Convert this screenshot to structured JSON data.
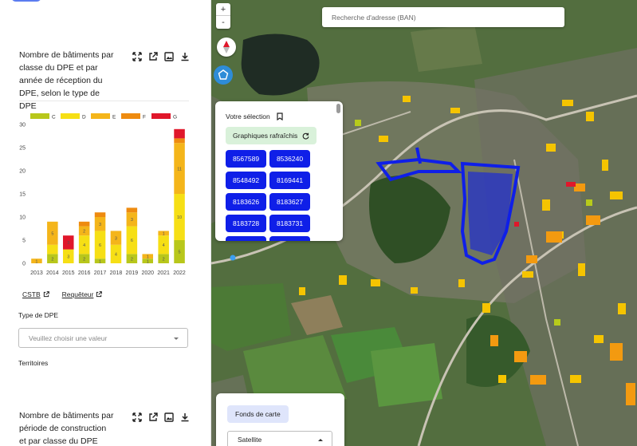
{
  "left_panel": {
    "card1": {
      "title": "Nombre de bâtiments par classe du DPE et par année de réception du DPE, selon le type de DPE"
    },
    "links": {
      "cstb": "CSTB",
      "requeteur": "Requêteur"
    },
    "type_dpe_label": "Type de DPE",
    "type_dpe_placeholder": "Veuillez choisir une valeur",
    "territoires_label": "Territoires",
    "card2": {
      "title": "Nombre de bâtiments par période de construction et par classe du DPE"
    },
    "tool_icons": [
      "expand-icon",
      "external-link-icon",
      "image-icon",
      "download-icon"
    ]
  },
  "map": {
    "zoom_in": "+",
    "zoom_out": "-",
    "search_placeholder": "Recherche d'adresse (BAN)",
    "selection": {
      "title": "Votre sélection",
      "refresh_label": "Graphiques rafraîchis",
      "ids": [
        "8567589",
        "8536240",
        "8548492",
        "8169441",
        "8183626",
        "8183627",
        "8183728",
        "8183731"
      ]
    },
    "basemap": {
      "button_label": "Fonds de carte",
      "selected": "Satellite"
    }
  },
  "colors": {
    "C": "#b8c71b",
    "D": "#f6df15",
    "E": "#f4b51a",
    "F": "#ee8b10",
    "G": "#e0172b",
    "selection": "#0f1fe8"
  },
  "chart_data": {
    "type": "bar",
    "stacked": true,
    "categories": [
      "2013",
      "2014",
      "2015",
      "2016",
      "2017",
      "2018",
      "2019",
      "2020",
      "2021",
      "2022"
    ],
    "series": [
      {
        "name": "C",
        "values": [
          0,
          2,
          0,
          2,
          1,
          0,
          2,
          1,
          2,
          5
        ]
      },
      {
        "name": "D",
        "values": [
          0,
          2,
          3,
          4,
          6,
          4,
          6,
          0,
          4,
          10
        ]
      },
      {
        "name": "E",
        "values": [
          1,
          5,
          0,
          2,
          3,
          3,
          3,
          1,
          1,
          11
        ]
      },
      {
        "name": "F",
        "values": [
          0,
          0,
          0,
          1,
          1,
          0,
          1,
          0,
          0,
          1
        ]
      },
      {
        "name": "G",
        "values": [
          0,
          0,
          3,
          0,
          0,
          0,
          0,
          0,
          0,
          2
        ]
      }
    ],
    "data_labels": [
      [
        "",
        "2",
        "",
        "2",
        "1",
        "",
        "2",
        "1",
        "2",
        "5"
      ],
      [
        "",
        "",
        "3",
        "4",
        "6",
        "4",
        "6",
        "",
        "4",
        "10"
      ],
      [
        "1",
        "5",
        "",
        "2",
        "3",
        "3",
        "3",
        "1",
        "1",
        "11"
      ],
      [
        "",
        "",
        "",
        "",
        "",
        "",
        "",
        "",
        "",
        ""
      ],
      [
        "",
        "",
        "3",
        "",
        "",
        "",
        "",
        "",
        "",
        ""
      ]
    ],
    "ylim": [
      0,
      30
    ],
    "yticks": [
      0,
      5,
      10,
      15,
      20,
      25,
      30
    ],
    "legend": "top",
    "grid": false
  }
}
